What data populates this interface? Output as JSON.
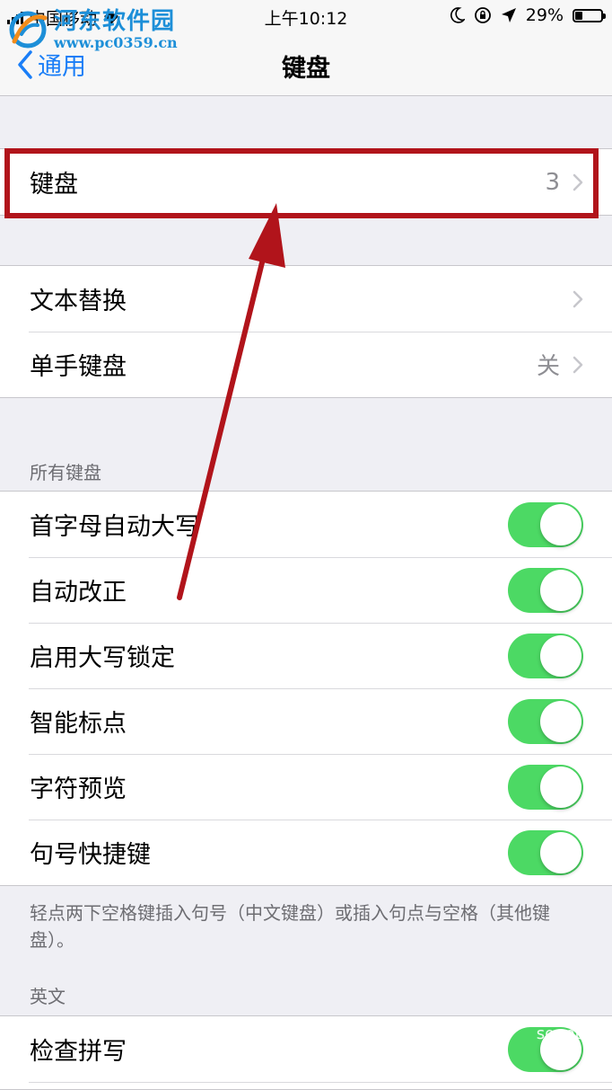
{
  "status_bar": {
    "carrier": "中国移动",
    "time": "上午10:12",
    "battery_percent": "29%",
    "battery_level": 0.29,
    "icons": [
      "signal-icon",
      "wifi-icon",
      "moon-icon",
      "rotation-lock-icon",
      "location-icon",
      "battery-icon"
    ]
  },
  "watermark": {
    "title": "河东软件园",
    "url": "www.pc0359.cn",
    "corner_text": "sogou"
  },
  "nav": {
    "back_label": "通用",
    "title": "键盘"
  },
  "keyboards_row": {
    "label": "键盘",
    "value": "3"
  },
  "group2": [
    {
      "label": "文本替换",
      "value": ""
    },
    {
      "label": "单手键盘",
      "value": "关"
    }
  ],
  "all_keyboards": {
    "header": "所有键盘",
    "toggles": [
      {
        "label": "首字母自动大写",
        "on": true
      },
      {
        "label": "自动改正",
        "on": true
      },
      {
        "label": "启用大写锁定",
        "on": true
      },
      {
        "label": "智能标点",
        "on": true
      },
      {
        "label": "字符预览",
        "on": true
      },
      {
        "label": "句号快捷键",
        "on": true
      }
    ],
    "footer": "轻点两下空格键插入句号（中文键盘）或插入句点与空格（其他键盘）。"
  },
  "english": {
    "header": "英文",
    "toggles": [
      {
        "label": "检查拼写",
        "on": true
      }
    ]
  },
  "colors": {
    "accent": "#1a7ef7",
    "toggle_on": "#4cd964",
    "annotation": "#b1141b"
  }
}
